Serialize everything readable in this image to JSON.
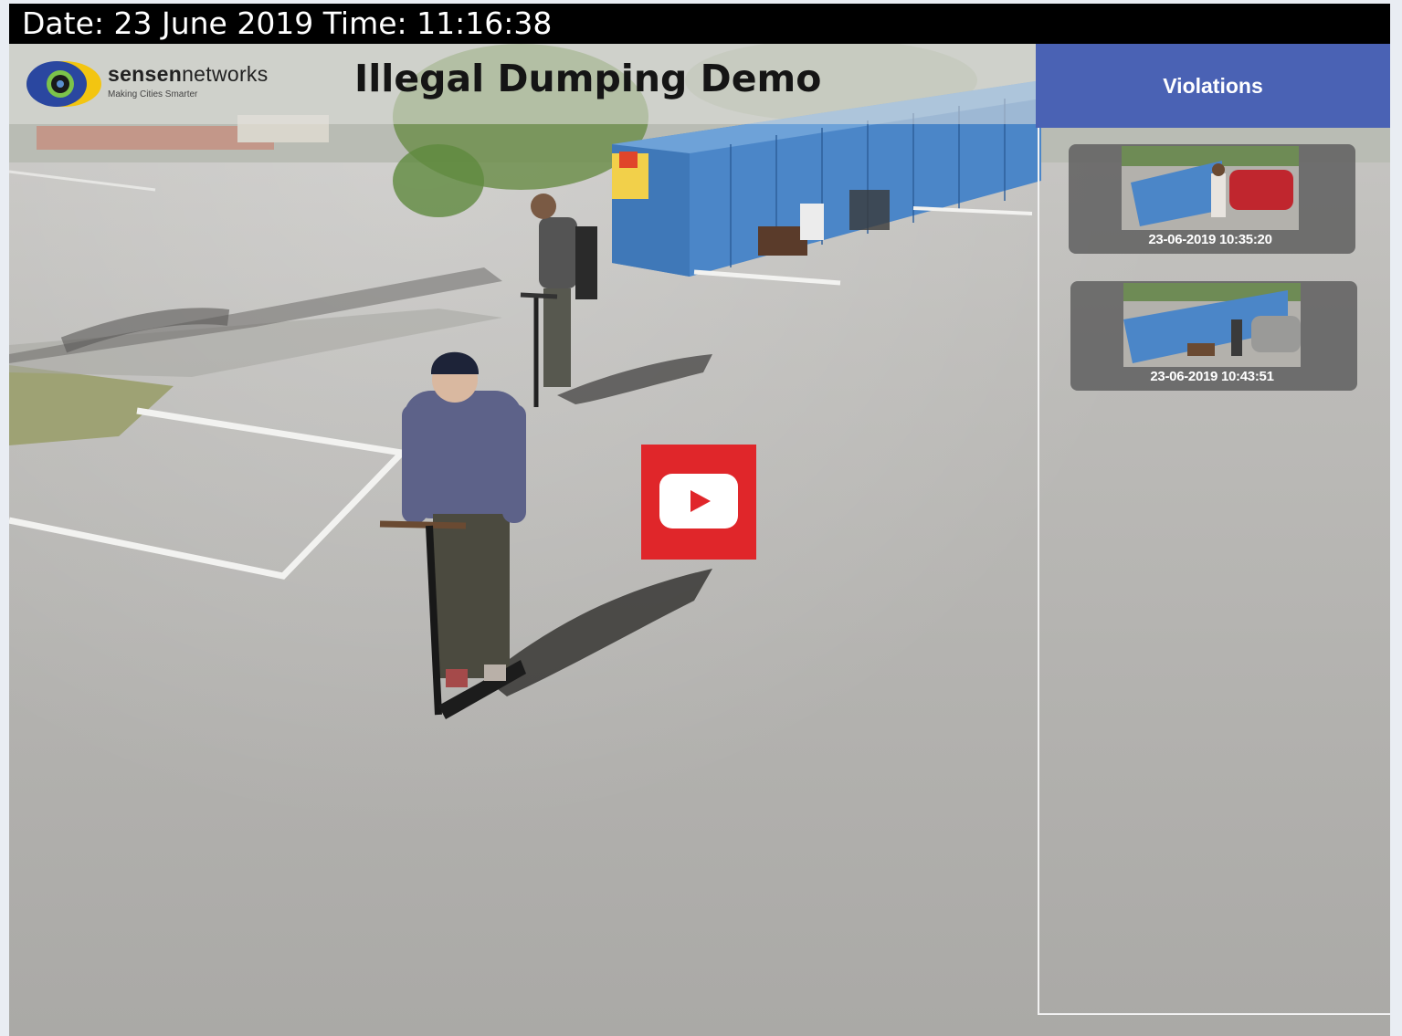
{
  "datebar": {
    "text": "Date: 23 June 2019 Time: 11:16:38"
  },
  "header": {
    "logo_brand_bold": "sensen",
    "logo_brand_rest": "networks",
    "logo_tagline": "Making Cities Smarter",
    "title": "Illegal Dumping Demo"
  },
  "violations": {
    "heading": "Violations",
    "items": [
      {
        "timestamp": "23-06-2019 10:35:20"
      },
      {
        "timestamp": "23-06-2019 10:43:51"
      }
    ]
  },
  "colors": {
    "violations_header": "#4a62b4",
    "play_button": "#e0262a",
    "bins": "#4b86c8"
  },
  "icons": {
    "logo": "sensen-eye-icon",
    "play": "youtube-play-icon"
  }
}
